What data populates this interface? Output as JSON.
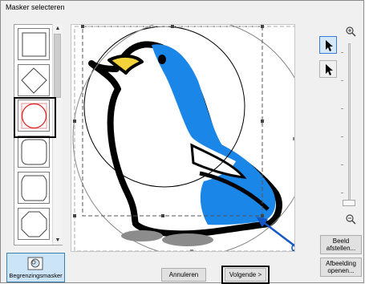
{
  "dialog": {
    "title": "Masker selecteren"
  },
  "shape_list": {
    "items": [
      {
        "shape": "rectangle"
      },
      {
        "shape": "diamond"
      },
      {
        "shape": "circle",
        "selected": true
      },
      {
        "shape": "octagon-rounded"
      },
      {
        "shape": "scalloped-square"
      },
      {
        "shape": "octagon"
      }
    ]
  },
  "tools": {
    "select_icon": "arrow-select-icon",
    "point_icon": "arrow-point-icon",
    "zoom_in_icon": "zoom-in-icon",
    "zoom_out_icon": "zoom-out-icon",
    "zoom_level": 0.0
  },
  "buttons": {
    "fit_label_line1": "Beeld",
    "fit_label_line2": "afstellen...",
    "open_label_line1": "Afbeelding",
    "open_label_line2": "openen...",
    "cancel_label": "Annuleren",
    "next_label": "Volgende >",
    "mask_label": "Begrenzingsmasker"
  },
  "colors": {
    "accent_blue": "#0a6fe8",
    "selection_red": "#d92020",
    "penguin_blue": "#1a87e8",
    "beak_yellow": "#f2d33a",
    "feet_grey": "#8c8c8c"
  }
}
